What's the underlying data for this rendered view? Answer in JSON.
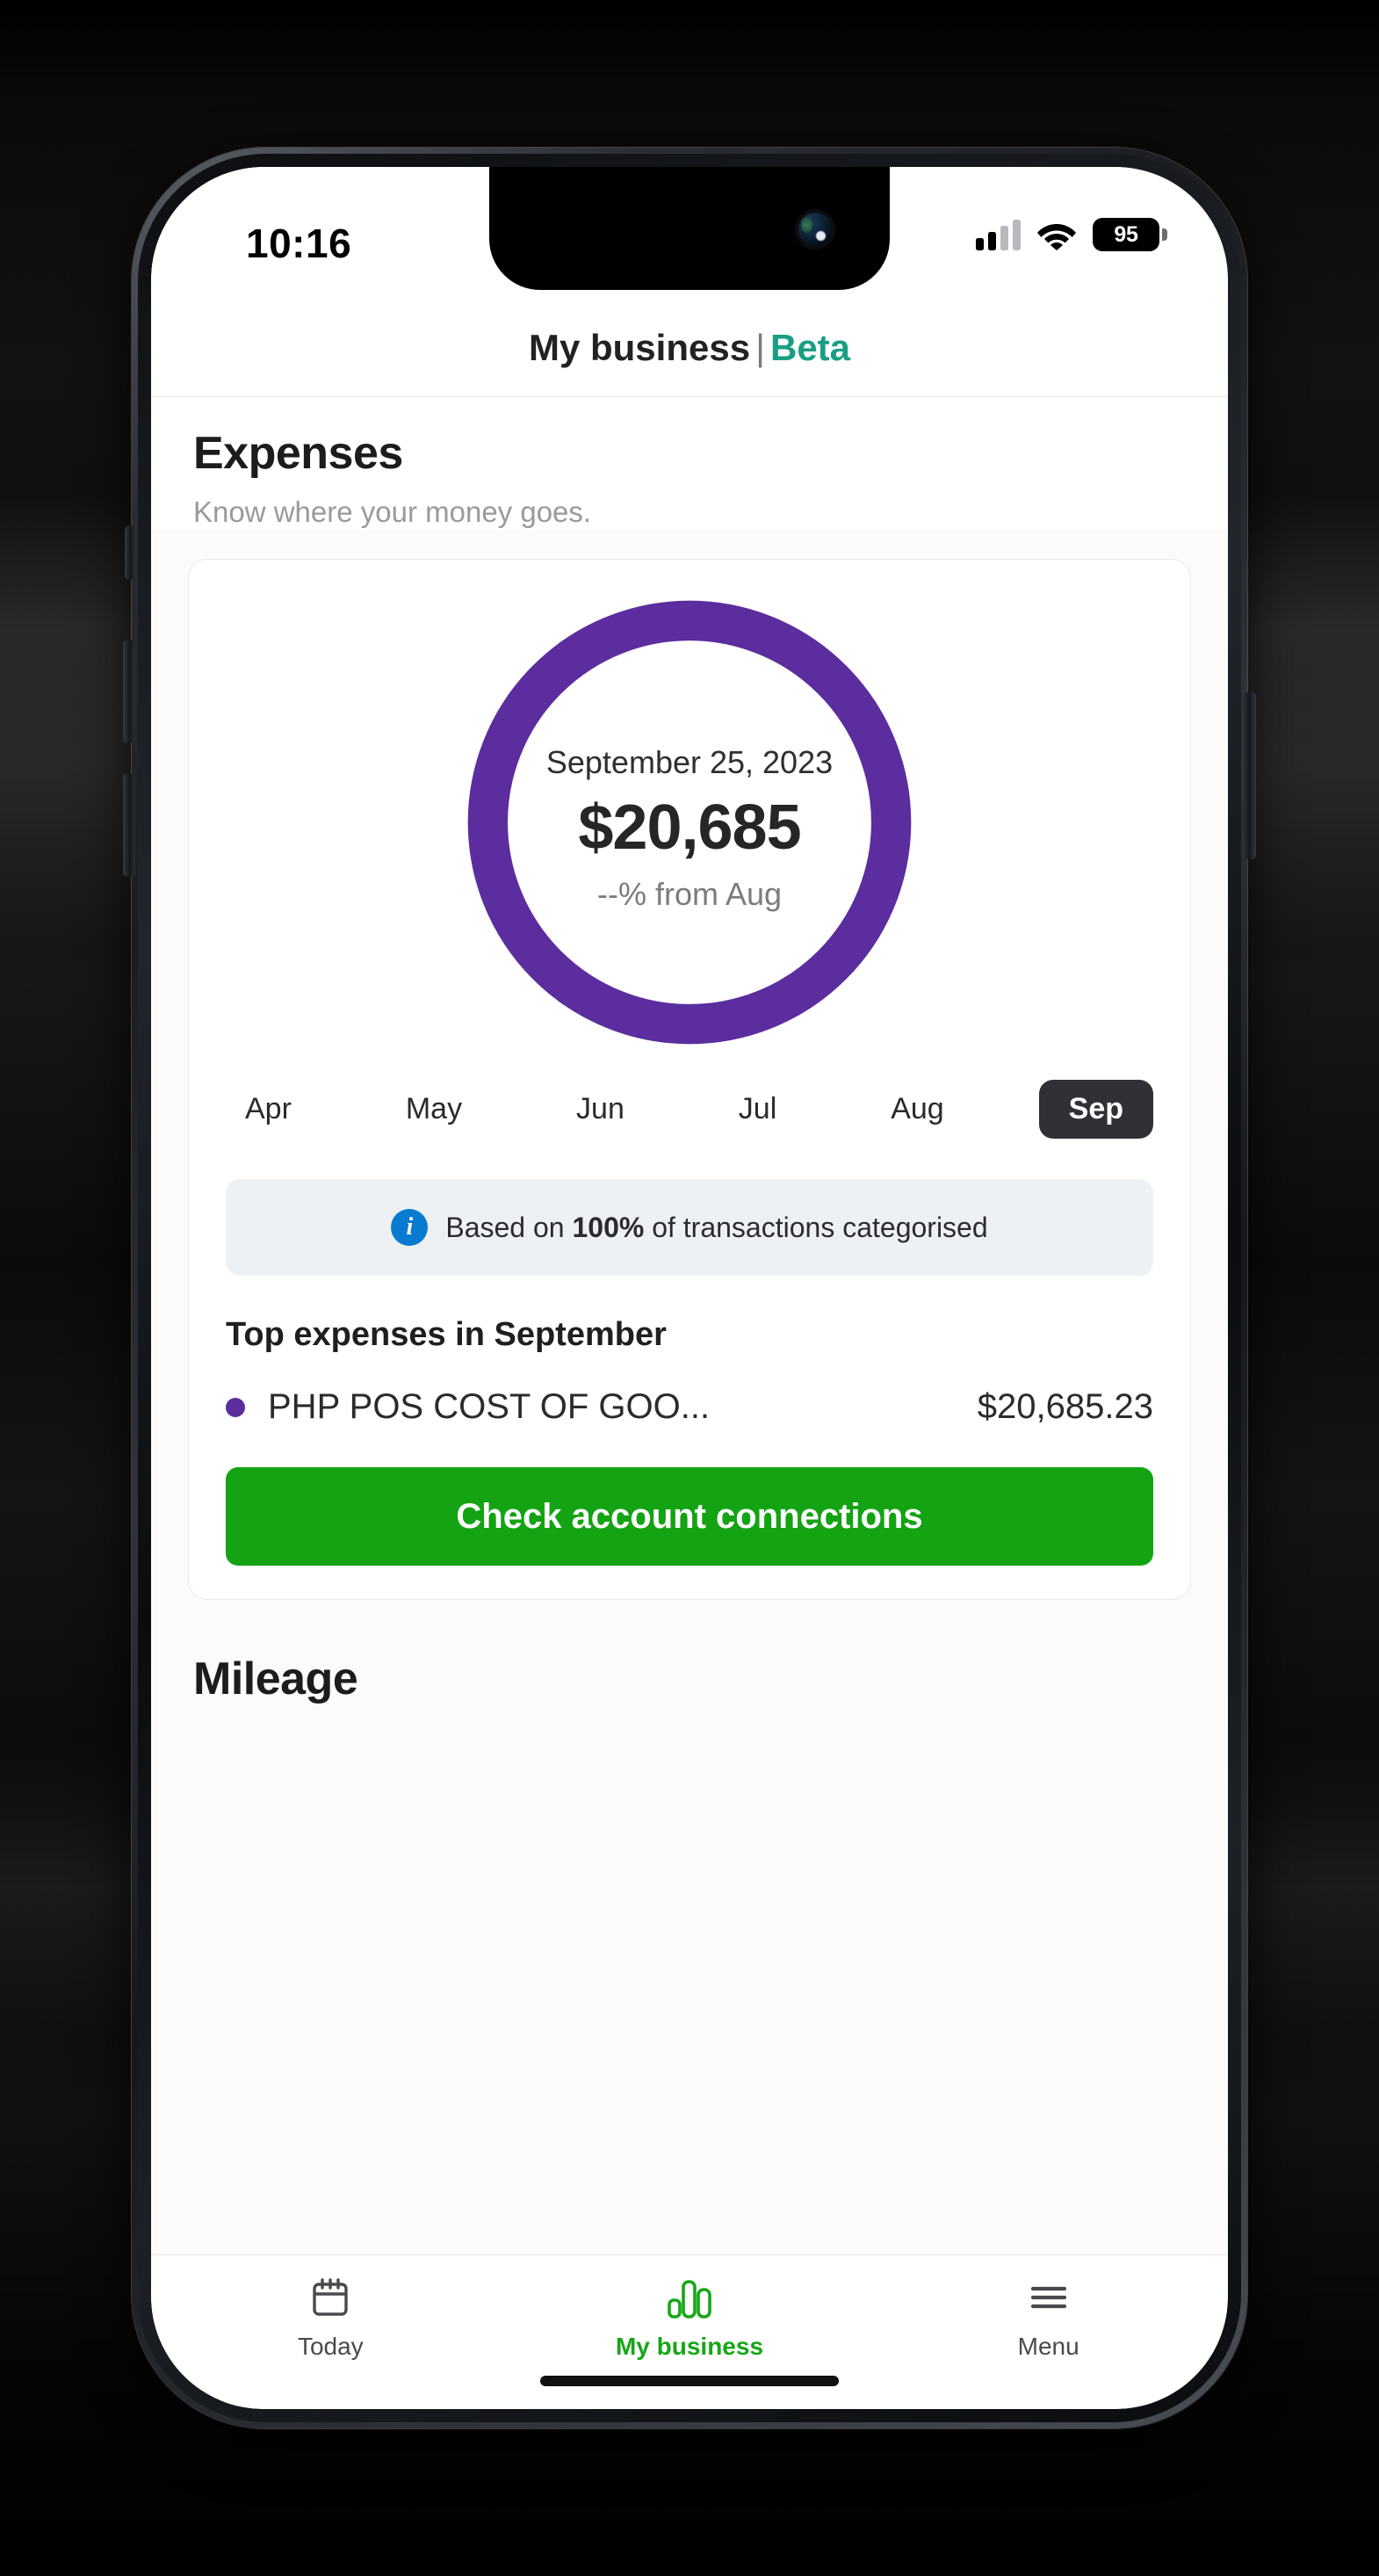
{
  "status_bar": {
    "time": "10:16",
    "battery_level": "95",
    "signal_icon": "cellular-signal-icon",
    "wifi_icon": "wifi-icon",
    "battery_icon": "battery-icon"
  },
  "header": {
    "title": "My business",
    "divider": "|",
    "badge": "Beta",
    "badge_color": "#1a9e85"
  },
  "expenses": {
    "title": "Expenses",
    "subtitle": "Know where your money goes.",
    "donut": {
      "date": "September 25, 2023",
      "amount": "$20,685",
      "delta": "--% from Aug",
      "ring_color": "#5b2d9e",
      "track_color": "#ffffff"
    },
    "months": [
      {
        "label": "Apr",
        "active": false
      },
      {
        "label": "May",
        "active": false
      },
      {
        "label": "Jun",
        "active": false
      },
      {
        "label": "Jul",
        "active": false
      },
      {
        "label": "Aug",
        "active": false
      },
      {
        "label": "Sep",
        "active": true
      }
    ],
    "banner": {
      "icon": "info-icon",
      "prefix": "Based on ",
      "highlight": "100%",
      "suffix": " of transactions categorised",
      "icon_color": "#0a7ad1"
    },
    "top_expenses_title": "Top expenses in September",
    "top_expenses": [
      {
        "dot_color": "#5b2d9e",
        "name": "PHP POS COST OF GOO...",
        "amount": "$20,685.23"
      }
    ],
    "cta_label": "Check account connections",
    "cta_color": "#13a313"
  },
  "mileage": {
    "title": "Mileage"
  },
  "tabbar": {
    "items": [
      {
        "label": "Today",
        "icon": "calendar-icon",
        "active": false
      },
      {
        "label": "My business",
        "icon": "bar-chart-icon",
        "active": true
      },
      {
        "label": "Menu",
        "icon": "hamburger-menu-icon",
        "active": false
      }
    ],
    "active_color": "#16a716"
  },
  "chart_data": {
    "type": "pie",
    "title": "September 25, 2023",
    "total": 20685,
    "total_label": "$20,685",
    "comparison": "--% from Aug",
    "categories": [
      "PHP POS COST OF GOO..."
    ],
    "values": [
      20685.23
    ],
    "value_labels": [
      "$20,685.23"
    ],
    "colors": [
      "#5b2d9e"
    ],
    "percent_categorised": 100,
    "period_selector": [
      "Apr",
      "May",
      "Jun",
      "Jul",
      "Aug",
      "Sep"
    ],
    "selected_period": "Sep",
    "legend_position": "below",
    "donut": true
  }
}
